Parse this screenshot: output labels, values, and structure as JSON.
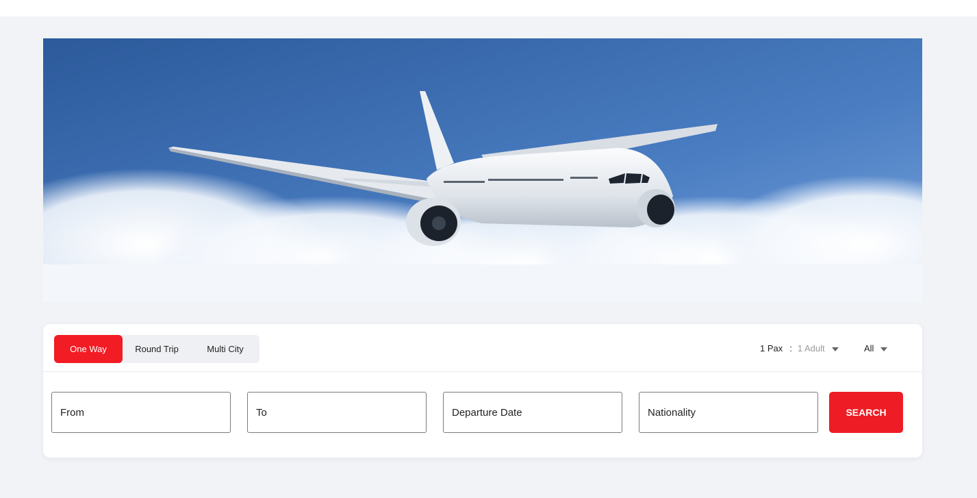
{
  "trip_tabs": [
    {
      "label": "One Way",
      "active": true
    },
    {
      "label": "Round Trip",
      "active": false
    },
    {
      "label": "Multi City",
      "active": false
    }
  ],
  "passengers": {
    "count_label": "1 Pax",
    "separator": ":",
    "adult_label": "1 Adult"
  },
  "cabin_class": {
    "selected": "All"
  },
  "fields": {
    "from": "From",
    "to": "To",
    "departure_date": "Departure Date",
    "nationality": "Nationality"
  },
  "search_label": "SEARCH",
  "colors": {
    "accent": "#ee1c24",
    "page_bg": "#f1f3f6",
    "sky_top": "#2f5fa0",
    "sky_bottom": "#6c9bd6"
  }
}
